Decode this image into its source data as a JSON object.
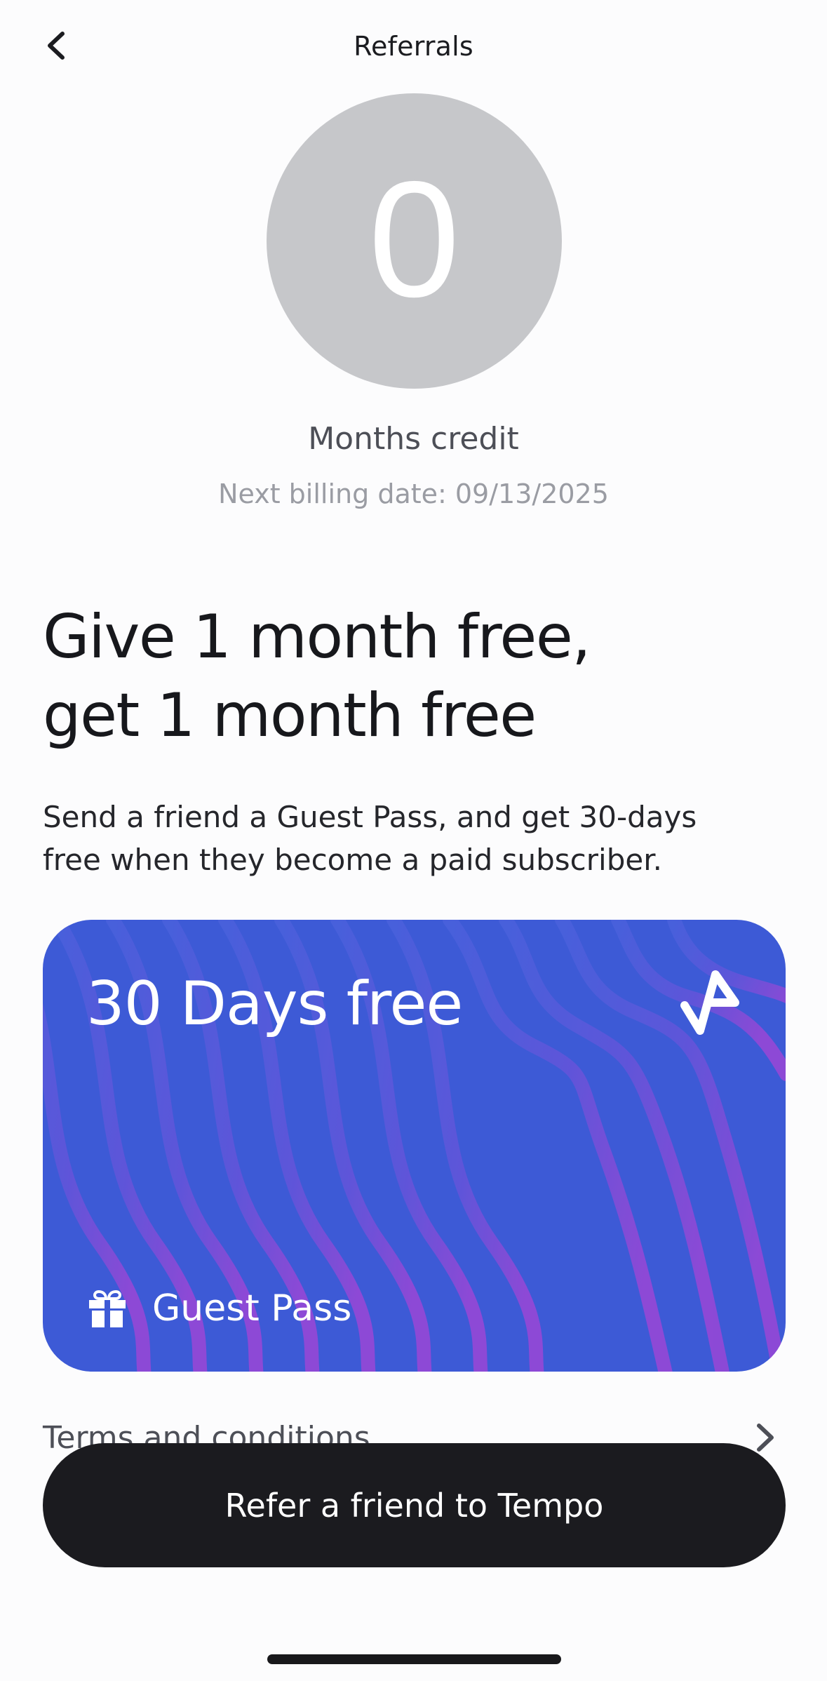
{
  "header": {
    "title": "Referrals",
    "back_icon": "chevron-left-icon"
  },
  "credit": {
    "value": "0",
    "label": "Months credit",
    "billing_date": "Next billing date: 09/13/2025"
  },
  "promo": {
    "headline_line1": "Give 1 month free,",
    "headline_line2": "get 1 month free",
    "description_line1": "Send a friend a Guest Pass, and get 30-days",
    "description_line2": "free when they become a paid subscriber."
  },
  "guest_pass_card": {
    "headline": "30 Days free",
    "label": "Guest Pass",
    "logo_icon": "tempo-logo-icon",
    "gift_icon": "gift-icon",
    "colors": {
      "base": "#3d5ad6",
      "accent": "#9b47d6"
    }
  },
  "terms": {
    "label": "Terms and conditions",
    "chevron_icon": "chevron-right-icon"
  },
  "cta": {
    "label": "Refer a friend to Tempo"
  }
}
